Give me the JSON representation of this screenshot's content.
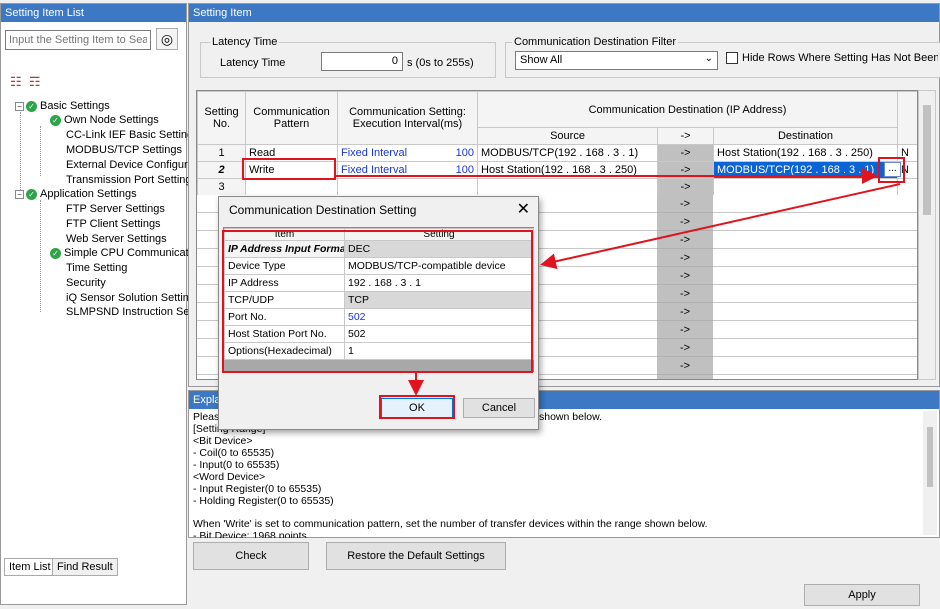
{
  "left_panel": {
    "title": "Setting Item List",
    "search_placeholder": "Input the Setting Item to Search",
    "tree": {
      "basic": "Basic Settings",
      "own_node": "Own Node Settings",
      "cclink": "CC-Link IEF Basic Setting",
      "modbus": "MODBUS/TCP Settings",
      "external": "External Device Configura",
      "transmission": "Transmission Port Setting",
      "application": "Application Settings",
      "ftp_server": "FTP Server Settings",
      "ftp_client": "FTP Client Settings",
      "web_server": "Web Server Settings",
      "simple_cpu": "Simple CPU Communicati",
      "time": "Time Setting",
      "security": "Security",
      "iq_sensor": "iQ Sensor Solution Setting",
      "slmp": "SLMPSND Instruction Se"
    },
    "tabs": [
      "Item List",
      "Find Result"
    ]
  },
  "right_panel": {
    "title": "Setting Item",
    "latency": {
      "group_label": "Latency Time",
      "field_label": "Latency Time",
      "value": "0",
      "unit": "s (0s to 255s)"
    },
    "filter": {
      "group_label": "Communication Destination Filter",
      "selected": "Show All",
      "hide_label": "Hide Rows Where Setting Has Not Been S"
    },
    "table": {
      "headers": {
        "no": "Setting No.",
        "pattern": "Communication Pattern",
        "interval": "Communication Setting: Execution Interval(ms)",
        "dest_group": "Communication Destination (IP Address)",
        "source": "Source",
        "arrow": "->",
        "destination": "Destination"
      },
      "rows": [
        {
          "no": "1",
          "pattern": "Read",
          "interval": "Fixed Interval",
          "ms": "100",
          "source": "MODBUS/TCP(192 . 168 .  3 .  1)",
          "arrow": "->",
          "destination": "Host Station(192 . 168 .  3 . 250)",
          "extra": "N"
        },
        {
          "no": "2",
          "pattern": "Write",
          "interval": "Fixed Interval",
          "ms": "100",
          "source": "Host Station(192 . 168 .  3 . 250)",
          "arrow": "->",
          "destination": "MODBUS/TCP(192 . 168 .  3 .  1)",
          "extra": "N"
        },
        {
          "no": "3",
          "pattern": "",
          "interval": "",
          "ms": "",
          "source": "",
          "arrow": "->",
          "destination": "",
          "extra": ""
        }
      ],
      "row_arrow": "->",
      "browse_label": "..."
    }
  },
  "dialog": {
    "title": "Communication Destination Setting",
    "col_item": "Item",
    "col_setting": "Setting",
    "rows": [
      {
        "item": "IP Address Input Format",
        "setting": "DEC"
      },
      {
        "item": "Device Type",
        "setting": "MODBUS/TCP-compatible device"
      },
      {
        "item": "IP Address",
        "setting": "192 . 168 .  3 .  1"
      },
      {
        "item": "TCP/UDP",
        "setting": "TCP"
      },
      {
        "item": "Port No.",
        "setting": "502"
      },
      {
        "item": "Host Station Port No.",
        "setting": "502"
      },
      {
        "item": "Options(Hexadecimal)",
        "setting": "1"
      }
    ],
    "ok": "OK",
    "cancel": "Cancel"
  },
  "explanation": {
    "title": "Explan",
    "lines": [
      "Please",
      "[Setting Range]",
      "<Bit Device>",
      " - Coil(0 to 65535)",
      " - Input(0 to 65535)",
      "<Word Device>",
      " - Input Register(0 to 65535)",
      " - Holding Register(0 to 65535)",
      "",
      "When 'Write' is set to communication pattern, set the number of transfer devices within the range shown below.",
      " - Bit Device: 1968 points"
    ],
    "partial_right": "shown below."
  },
  "buttons": {
    "check": "Check",
    "restore": "Restore the Default Settings",
    "apply": "Apply"
  }
}
